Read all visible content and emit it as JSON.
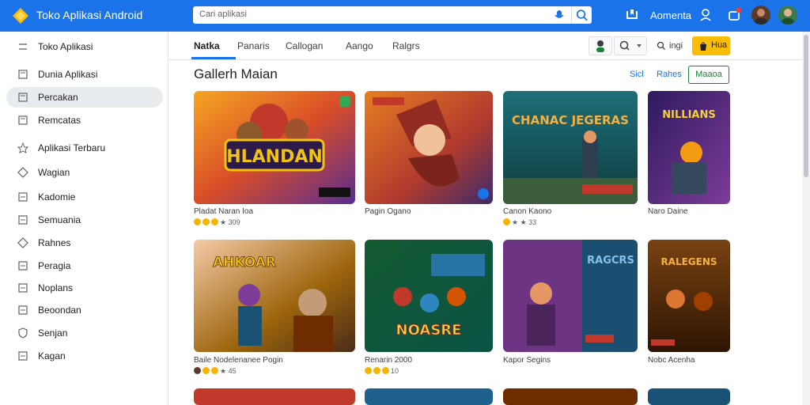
{
  "app": {
    "brand": "Toko Aplikasi Android",
    "account_name": "Aomenta"
  },
  "search": {
    "placeholder": "Cari aplikasi"
  },
  "sidebar": {
    "items": [
      {
        "label": "Toko Aplikasi",
        "icon": "grid-icon"
      },
      {
        "label": "Dunia Aplikasi",
        "icon": "doc-icon"
      },
      {
        "label": "Percakan",
        "icon": "doc-icon",
        "active": true
      },
      {
        "label": "Remcatas",
        "icon": "doc-icon"
      },
      {
        "label": "Aplikasi Terbaru",
        "icon": "star-icon"
      },
      {
        "label": "Wagian",
        "icon": "diamond-icon"
      },
      {
        "label": "Kadomie",
        "icon": "doc-icon"
      },
      {
        "label": "Semuania",
        "icon": "doc-icon"
      },
      {
        "label": "Rahnes",
        "icon": "diamond-icon"
      },
      {
        "label": "Peragia",
        "icon": "doc-icon"
      },
      {
        "label": "Noplans",
        "icon": "doc-icon"
      },
      {
        "label": "Beoondan",
        "icon": "doc-icon"
      },
      {
        "label": "Senjan",
        "icon": "shield-icon"
      },
      {
        "label": "Kagan",
        "icon": "doc-icon"
      }
    ]
  },
  "tabs": [
    {
      "label": "Natka",
      "active": true
    },
    {
      "label": "Panaris"
    },
    {
      "label": "Callogan"
    },
    {
      "label": "Aango"
    },
    {
      "label": "Ralgrs"
    }
  ],
  "toolbar": {
    "filter_label": "ingi",
    "yellow_label": "Hua"
  },
  "section": {
    "title": "Gallerh Maian",
    "link1": "Sicl",
    "link2": "Rahes",
    "button": "Maaoa"
  },
  "cards": [
    {
      "name": "Pladat Naran Ioa",
      "rating": "309",
      "title_art": "HLANDAN"
    },
    {
      "name": "Pagin Ogano",
      "rating": "",
      "title_art": ""
    },
    {
      "name": "Canon Kaono",
      "rating": "33",
      "title_art": "CHANAC JEGERAS"
    },
    {
      "name": "Naro Daine",
      "rating": "",
      "title_art": "NILLIANS"
    },
    {
      "name": "Baile Nodelenanee Pogin",
      "rating": "45",
      "title_art": "AHKOAR"
    },
    {
      "name": "Renarin 2000",
      "rating": "10",
      "title_art": "NOASRE"
    },
    {
      "name": "Kapor Segins",
      "rating": "",
      "title_art": "RAGCRS"
    },
    {
      "name": "Nobc Acenha",
      "rating": "",
      "title_art": "RALEGENS"
    }
  ],
  "colors": {
    "topbar": "#1a73e8",
    "accent_green": "#188038",
    "yellow": "#fbbc04"
  }
}
